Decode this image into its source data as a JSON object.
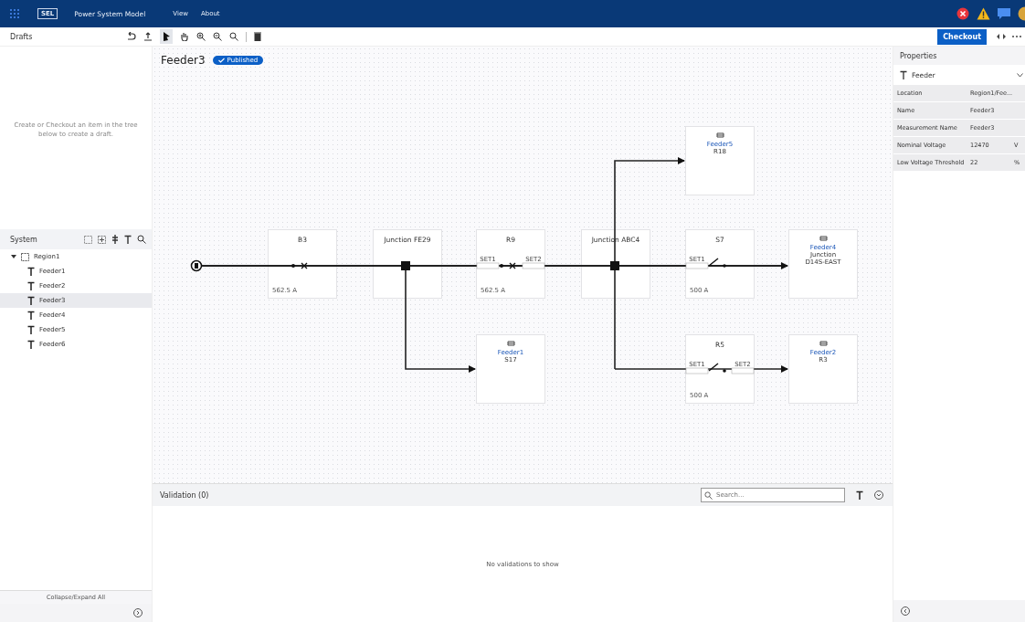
{
  "app_bar": {
    "logo": "SEL",
    "title": "Power System Model",
    "menu": [
      "View",
      "About"
    ]
  },
  "toolbar": {
    "panel_title": "Drafts",
    "checkout": "Checkout"
  },
  "drafts": {
    "message": "Create or Checkout an item in the tree below to create a draft."
  },
  "system": {
    "title": "System",
    "tree": [
      {
        "label": "Region1",
        "expanded": true,
        "selected": false,
        "children": [
          {
            "label": "Feeder1",
            "selected": false
          },
          {
            "label": "Feeder2",
            "selected": false
          },
          {
            "label": "Feeder3",
            "selected": true
          },
          {
            "label": "Feeder4",
            "selected": false
          },
          {
            "label": "Feeder5",
            "selected": false
          },
          {
            "label": "Feeder6",
            "selected": false
          }
        ]
      }
    ],
    "footer": "Collapse/Expand All"
  },
  "diagram": {
    "title": "Feeder3",
    "status": "Published",
    "nodes": [
      {
        "kind": "device",
        "title": "B3",
        "rating": "562.5 A",
        "open": false
      },
      {
        "kind": "junction",
        "title": "Junction FE29"
      },
      {
        "kind": "device",
        "title": "R9",
        "rating": "562.5 A",
        "settings": [
          "SET1",
          "SET2"
        ],
        "open": false
      },
      {
        "kind": "junction",
        "title": "Junction ABC4"
      },
      {
        "kind": "device",
        "title": "S7",
        "rating": "500 A",
        "settings": [
          "SET1"
        ],
        "open": true
      },
      {
        "kind": "link",
        "feeder": "Feeder4",
        "lines": [
          "Junction",
          "D14S-EAST"
        ]
      },
      {
        "kind": "link",
        "feeder": "Feeder5",
        "lines": [
          "R18"
        ]
      },
      {
        "kind": "link",
        "feeder": "Feeder1",
        "lines": [
          "S17"
        ]
      },
      {
        "kind": "device",
        "title": "R5",
        "rating": "500 A",
        "settings": [
          "SET1",
          "SET2"
        ],
        "open": true
      },
      {
        "kind": "link",
        "feeder": "Feeder2",
        "lines": [
          "R3"
        ]
      }
    ]
  },
  "validation": {
    "title": "Validation (0)",
    "search_placeholder": "Search...",
    "empty": "No validations to show"
  },
  "properties": {
    "title": "Properties",
    "type": "Feeder",
    "rows": [
      {
        "label": "Location",
        "value": "Region1/Fee..."
      },
      {
        "label": "Name",
        "value": "Feeder3"
      },
      {
        "label": "Measurement Name",
        "value": "Feeder3"
      },
      {
        "label": "Nominal Voltage",
        "value": "12470",
        "unit": "V"
      },
      {
        "label": "Low Voltage Threshold",
        "value": "22",
        "unit": "%"
      }
    ]
  }
}
